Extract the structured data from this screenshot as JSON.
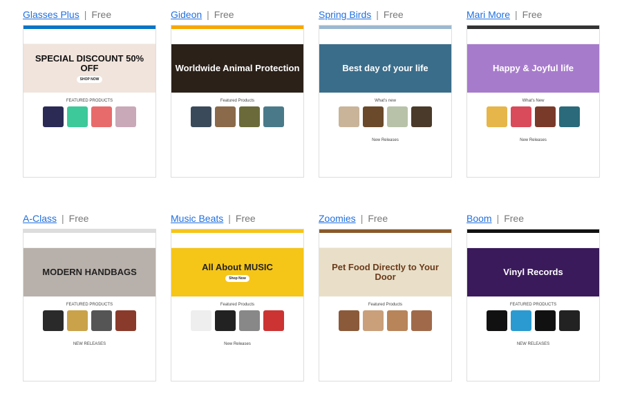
{
  "themes": [
    {
      "name": "Glasses Plus",
      "price": "Free",
      "accent": "#0a74c4",
      "banner_bg": "#f1e4dc",
      "banner_fg": "#111",
      "banner_text": "SPECIAL DISCOUNT 50% OFF",
      "banner_button": "SHOP NOW",
      "section1": "FEATURED PRODUCTS",
      "section2": "",
      "products": [
        "#2a2a55",
        "#3dc99a",
        "#e86b6b",
        "#c9a8b8"
      ]
    },
    {
      "name": "Gideon",
      "price": "Free",
      "accent": "#f5a800",
      "banner_bg": "#2b2119",
      "banner_fg": "#fff",
      "banner_text": "Worldwide Animal Protection",
      "banner_button": "",
      "section1": "Featured Products",
      "section2": "",
      "products": [
        "#3b4a5a",
        "#8a6a4a",
        "#6b6a3a",
        "#4a7a8a"
      ]
    },
    {
      "name": "Spring Birds",
      "price": "Free",
      "accent": "#9cb8d0",
      "banner_bg": "#3a6d8a",
      "banner_fg": "#fff",
      "banner_text": "Best day of your life",
      "banner_button": "",
      "section1": "What's new",
      "section2": "New Releases",
      "products": [
        "#c9b49a",
        "#6a4a2a",
        "#b8c2a8",
        "#4a3a2a"
      ]
    },
    {
      "name": "Mari More",
      "price": "Free",
      "accent": "#333",
      "banner_bg": "#a77bcc",
      "banner_fg": "#fff",
      "banner_text": "Happy & Joyful life",
      "banner_button": "",
      "section1": "What's New",
      "section2": "New Releases",
      "products": [
        "#e6b64a",
        "#d94a5a",
        "#7a3a2a",
        "#2a6a7a"
      ]
    },
    {
      "name": "A-Class",
      "price": "Free",
      "accent": "#ddd",
      "banner_bg": "#b8b0aa",
      "banner_fg": "#222",
      "banner_text": "MODERN HANDBAGS",
      "banner_button": "",
      "section1": "FEATURED PRODUCTS",
      "section2": "NEW RELEASES",
      "products": [
        "#2a2a2a",
        "#c9a24a",
        "#555",
        "#8a3a2a"
      ]
    },
    {
      "name": "Music Beats",
      "price": "Free",
      "accent": "#f5c518",
      "banner_bg": "#f5c518",
      "banner_fg": "#222",
      "banner_text": "All About MUSIC",
      "banner_button": "Shop Now",
      "section1": "Featured Products",
      "section2": "New Releases",
      "products": [
        "#eee",
        "#222",
        "#888",
        "#c33"
      ]
    },
    {
      "name": "Zoomies",
      "price": "Free",
      "accent": "#8a5a2a",
      "banner_bg": "#e9dfc8",
      "banner_fg": "#6a3a1a",
      "banner_text": "Pet Food Directly to Your Door",
      "banner_button": "",
      "section1": "Featured Products",
      "section2": "",
      "products": [
        "#8a5a3a",
        "#c9a07a",
        "#b8845a",
        "#a06a4a"
      ]
    },
    {
      "name": "Boom",
      "price": "Free",
      "accent": "#111",
      "banner_bg": "#3a1a5a",
      "banner_fg": "#fff",
      "banner_text": "Vinyl Records",
      "banner_button": "",
      "section1": "FEATURED PRODUCTS",
      "section2": "NEW RELEASES",
      "products": [
        "#111",
        "#2a9ad0",
        "#111",
        "#222"
      ]
    }
  ]
}
